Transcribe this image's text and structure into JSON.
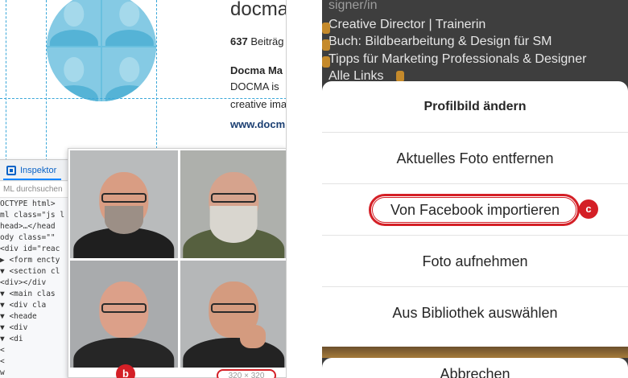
{
  "left": {
    "profile_name": "docma",
    "posts_count": "637",
    "posts_label": "Beiträg",
    "bio_name": "Docma Ma",
    "bio_lines": [
      "DOCMA is",
      "creative ima"
    ],
    "bio_link": "www.docm",
    "devtools": {
      "tab_label": "Inspektor",
      "search_placeholder": "ML durchsuchen",
      "code_lines": [
        "OCTYPE html>",
        "ml class=\"js l",
        "head>…</head",
        "ody class=\"\"",
        "<div id=\"reac",
        "▶ <form encty",
        "▼ <section cl",
        "    <div></div",
        "  ▼ <main clas",
        "    ▼ <div cla",
        "      ▼ <heade",
        "        ▼ <div",
        "          ▼ <di",
        "              <",
        "              <",
        "                w"
      ]
    },
    "preview_dims": "320 × 320",
    "marker_b": "b"
  },
  "right": {
    "bio_lines": [
      {
        "prefix": "",
        "text": "signer/in"
      },
      {
        "prefix": "",
        "text": "Creative Director | Trainerin"
      },
      {
        "prefix": "",
        "text": "Buch: Bildbearbeitung & Design für SM"
      },
      {
        "prefix": "",
        "text": "Tipps für Marketing Professionals & Designer"
      },
      {
        "prefix": "",
        "text": "Alle Links"
      }
    ],
    "sheet_title": "Profilbild ändern",
    "options": [
      "Aktuelles Foto entfernen",
      "Von Facebook importieren",
      "Foto aufnehmen",
      "Aus Bibliothek auswählen"
    ],
    "cancel_label": "Abbrechen",
    "marker_c": "c"
  },
  "colors": {
    "highlight_red": "#d41f26",
    "guide_blue": "#3aa7d9",
    "link_blue": "#1b3f72",
    "devtools_blue": "#0a63c7"
  },
  "icons": [
    "inspector-icon",
    "emoji-icon"
  ]
}
